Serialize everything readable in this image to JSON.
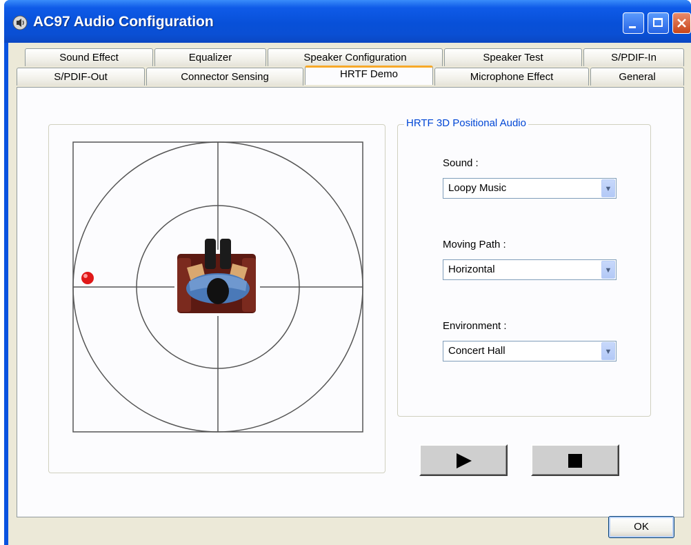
{
  "window": {
    "title": "AC97 Audio Configuration"
  },
  "tabs": {
    "row1": [
      "Sound Effect",
      "Equalizer",
      "Speaker Configuration",
      "Speaker Test",
      "S/PDIF-In"
    ],
    "row2": [
      "S/PDIF-Out",
      "Connector Sensing",
      "HRTF Demo",
      "Microphone Effect",
      "General"
    ],
    "active": "HRTF Demo"
  },
  "hrtf": {
    "group_title": "HRTF 3D Positional Audio",
    "sound": {
      "label": "Sound :",
      "value": "Loopy Music"
    },
    "moving_path": {
      "label": "Moving Path :",
      "value": "Horizontal"
    },
    "environment": {
      "label": "Environment :",
      "value": "Concert Hall"
    }
  },
  "buttons": {
    "ok": "OK",
    "play_icon": "play-icon",
    "stop_icon": "stop-icon"
  },
  "colors": {
    "titlebar": "#0a53e0",
    "face": "#ece9d8",
    "active_tab_accent": "#f7a928",
    "group_title": "#0046d5",
    "sound_source": "#e01818"
  }
}
